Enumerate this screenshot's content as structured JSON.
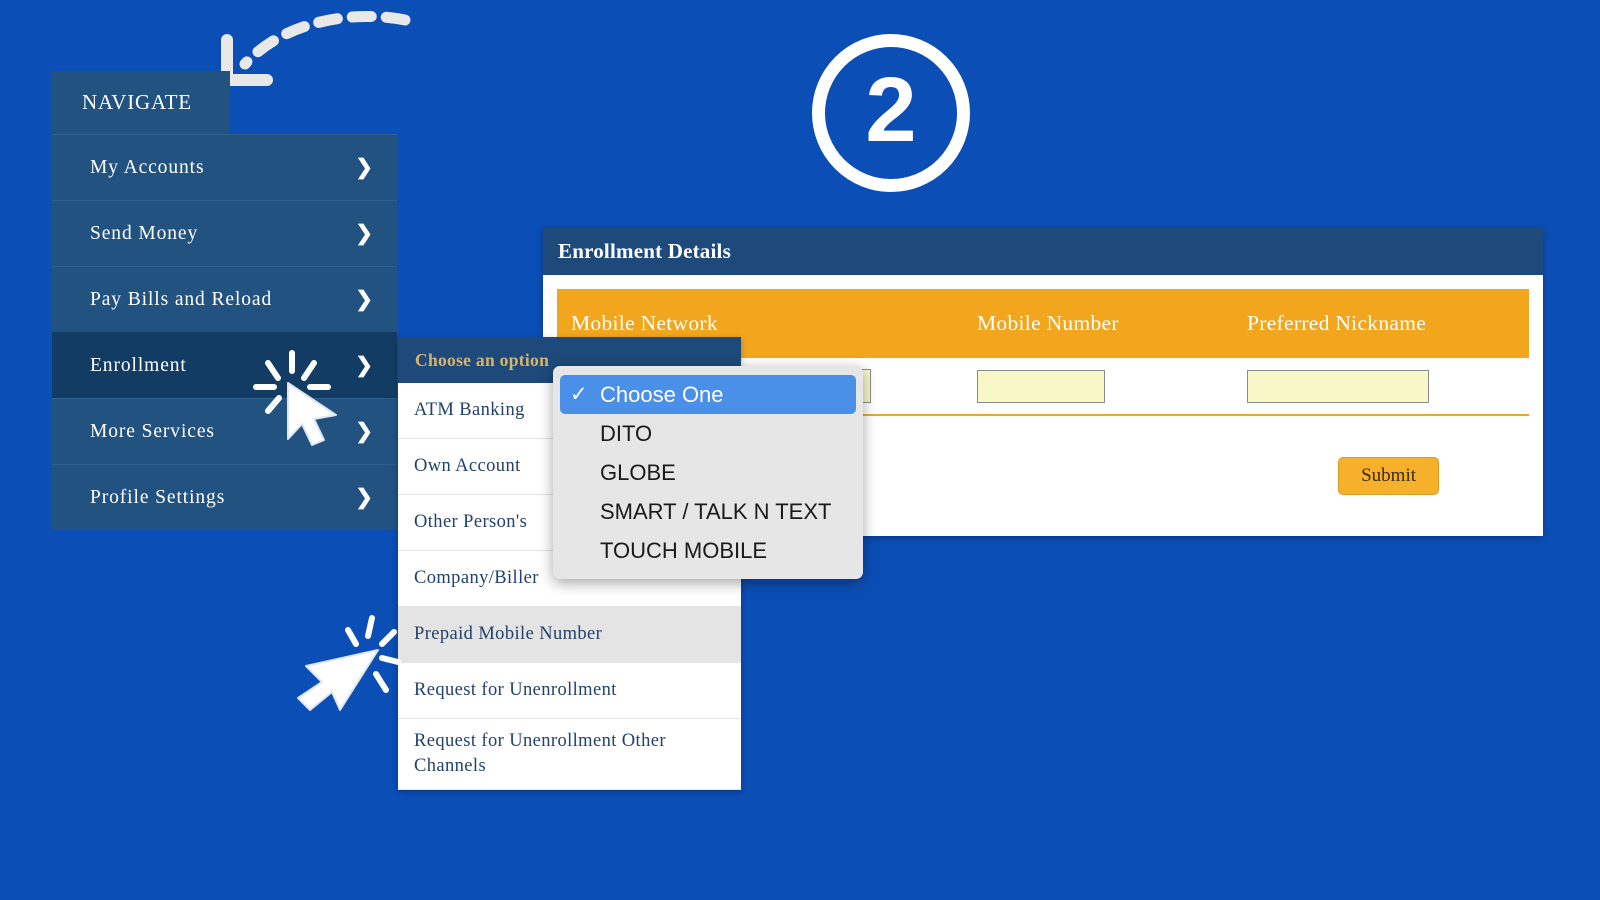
{
  "step": {
    "number": "2"
  },
  "sidebar": {
    "header": "NAVIGATE",
    "chevron": "❯",
    "items": [
      {
        "label": "My Accounts"
      },
      {
        "label": "Send Money"
      },
      {
        "label": "Pay Bills and Reload"
      },
      {
        "label": "Enrollment"
      },
      {
        "label": "More Services"
      },
      {
        "label": "Profile Settings"
      }
    ]
  },
  "submenu": {
    "header": "Choose an option",
    "items": [
      {
        "label": "ATM Banking"
      },
      {
        "label": "Own Account"
      },
      {
        "label": "Other Person's"
      },
      {
        "label": "Company/Biller"
      },
      {
        "label": "Prepaid Mobile Number"
      },
      {
        "label": "Request for Unenrollment"
      },
      {
        "label": "Request for Unenrollment Other Channels"
      }
    ]
  },
  "panel": {
    "title": "Enrollment Details",
    "columns": {
      "network": "Mobile Network",
      "number": "Mobile Number",
      "nickname": "Preferred Nickname"
    },
    "row": {
      "network_value": "",
      "number_value": "",
      "number_placeholder": "",
      "nickname_value": "",
      "nickname_placeholder": ""
    },
    "submit_label": "Submit"
  },
  "select_popup": {
    "check_glyph": "✓",
    "options": [
      {
        "label": "Choose One"
      },
      {
        "label": "DITO"
      },
      {
        "label": "GLOBE"
      },
      {
        "label": "SMART / TALK N TEXT"
      },
      {
        "label": "TOUCH MOBILE"
      }
    ]
  },
  "colors": {
    "page_background": "#0b4eb5",
    "sidebar": "#22527f",
    "sidebar_active": "#133c64",
    "panel_header": "#1d4a7a",
    "table_header_orange": "#f2a61e",
    "input_yellow": "#f7f7c8",
    "submit_button": "#f7b02c",
    "select_highlight": "#4a90e8",
    "submenu_header_text": "#d7b46a"
  }
}
